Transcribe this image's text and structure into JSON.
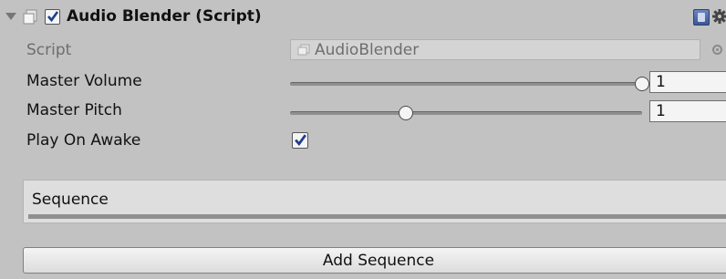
{
  "component": {
    "title": "Audio Blender (Script)",
    "enabled": true
  },
  "icons": {
    "foldout": "foldout-arrow-icon",
    "script": "script-file-icon",
    "help": "help-book-icon",
    "settings": "gear-icon",
    "object_picker": "object-picker-icon"
  },
  "fields": {
    "script_label": "Script",
    "script_value": "AudioBlender",
    "master_volume_label": "Master Volume",
    "master_volume_value": "1",
    "master_volume_fraction": 1.0,
    "master_pitch_label": "Master Pitch",
    "master_pitch_value": "1",
    "master_pitch_fraction": 0.33,
    "play_on_awake_label": "Play On Awake",
    "play_on_awake_checked": true
  },
  "sequence": {
    "header_label": "Sequence",
    "add_button_label": "Add Sequence"
  },
  "colors": {
    "background": "#c2c2c2",
    "help_icon_blue": "#3a5694"
  }
}
